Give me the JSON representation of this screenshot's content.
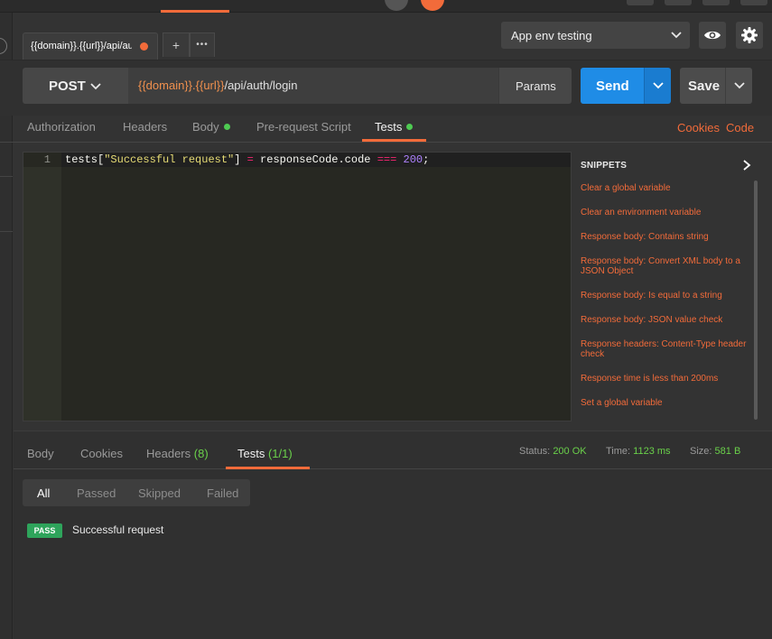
{
  "tab": {
    "title": "{{domain}}.{{url}}/api/auth/login",
    "add_label": "+",
    "more_label": "•••"
  },
  "environment": {
    "selected": "App env testing"
  },
  "request": {
    "method": "POST",
    "url_parts": [
      {
        "text": "{{domain}}",
        "kind": "var"
      },
      {
        "text": ".",
        "kind": "plain"
      },
      {
        "text": "{{url}}",
        "kind": "var"
      },
      {
        "text": "/api/auth/login",
        "kind": "plain"
      }
    ],
    "params_label": "Params",
    "send_label": "Send",
    "save_label": "Save"
  },
  "request_tabs": {
    "authorization": "Authorization",
    "headers": "Headers",
    "body": "Body",
    "prerequest": "Pre-request Script",
    "tests": "Tests",
    "cookies": "Cookies",
    "code": "Code"
  },
  "editor": {
    "line_number": "1",
    "tokens": [
      {
        "t": "tests[",
        "c": ""
      },
      {
        "t": "\"Successful request\"",
        "c": "str"
      },
      {
        "t": "] ",
        "c": ""
      },
      {
        "t": "=",
        "c": "op"
      },
      {
        "t": " responseCode.code ",
        "c": ""
      },
      {
        "t": "===",
        "c": "op"
      },
      {
        "t": " ",
        "c": ""
      },
      {
        "t": "200",
        "c": "num"
      },
      {
        "t": ";",
        "c": ""
      }
    ]
  },
  "snippets": {
    "heading": "SNIPPETS",
    "items": [
      "Clear a global variable",
      "Clear an environment variable",
      "Response body: Contains string",
      "Response body: Convert XML body to a JSON Object",
      "Response body: Is equal to a string",
      "Response body: JSON value check",
      "Response headers: Content-Type header check",
      "Response time is less than 200ms",
      "Set a global variable"
    ]
  },
  "response": {
    "tabs": {
      "body": "Body",
      "cookies": "Cookies",
      "headers": "Headers",
      "headers_count": "(8)",
      "tests": "Tests",
      "tests_count": "(1/1)"
    },
    "status_label": "Status:",
    "status_value": "200 OK",
    "time_label": "Time:",
    "time_value": "1123 ms",
    "size_label": "Size:",
    "size_value": "581 B",
    "filters": {
      "all": "All",
      "passed": "Passed",
      "skipped": "Skipped",
      "failed": "Failed"
    },
    "results": [
      {
        "badge": "PASS",
        "name": "Successful request"
      }
    ]
  },
  "colors": {
    "accent": "#f26b3a",
    "send": "#1f8ce6",
    "pass": "#2ea45b",
    "ok": "#6ad14a"
  }
}
